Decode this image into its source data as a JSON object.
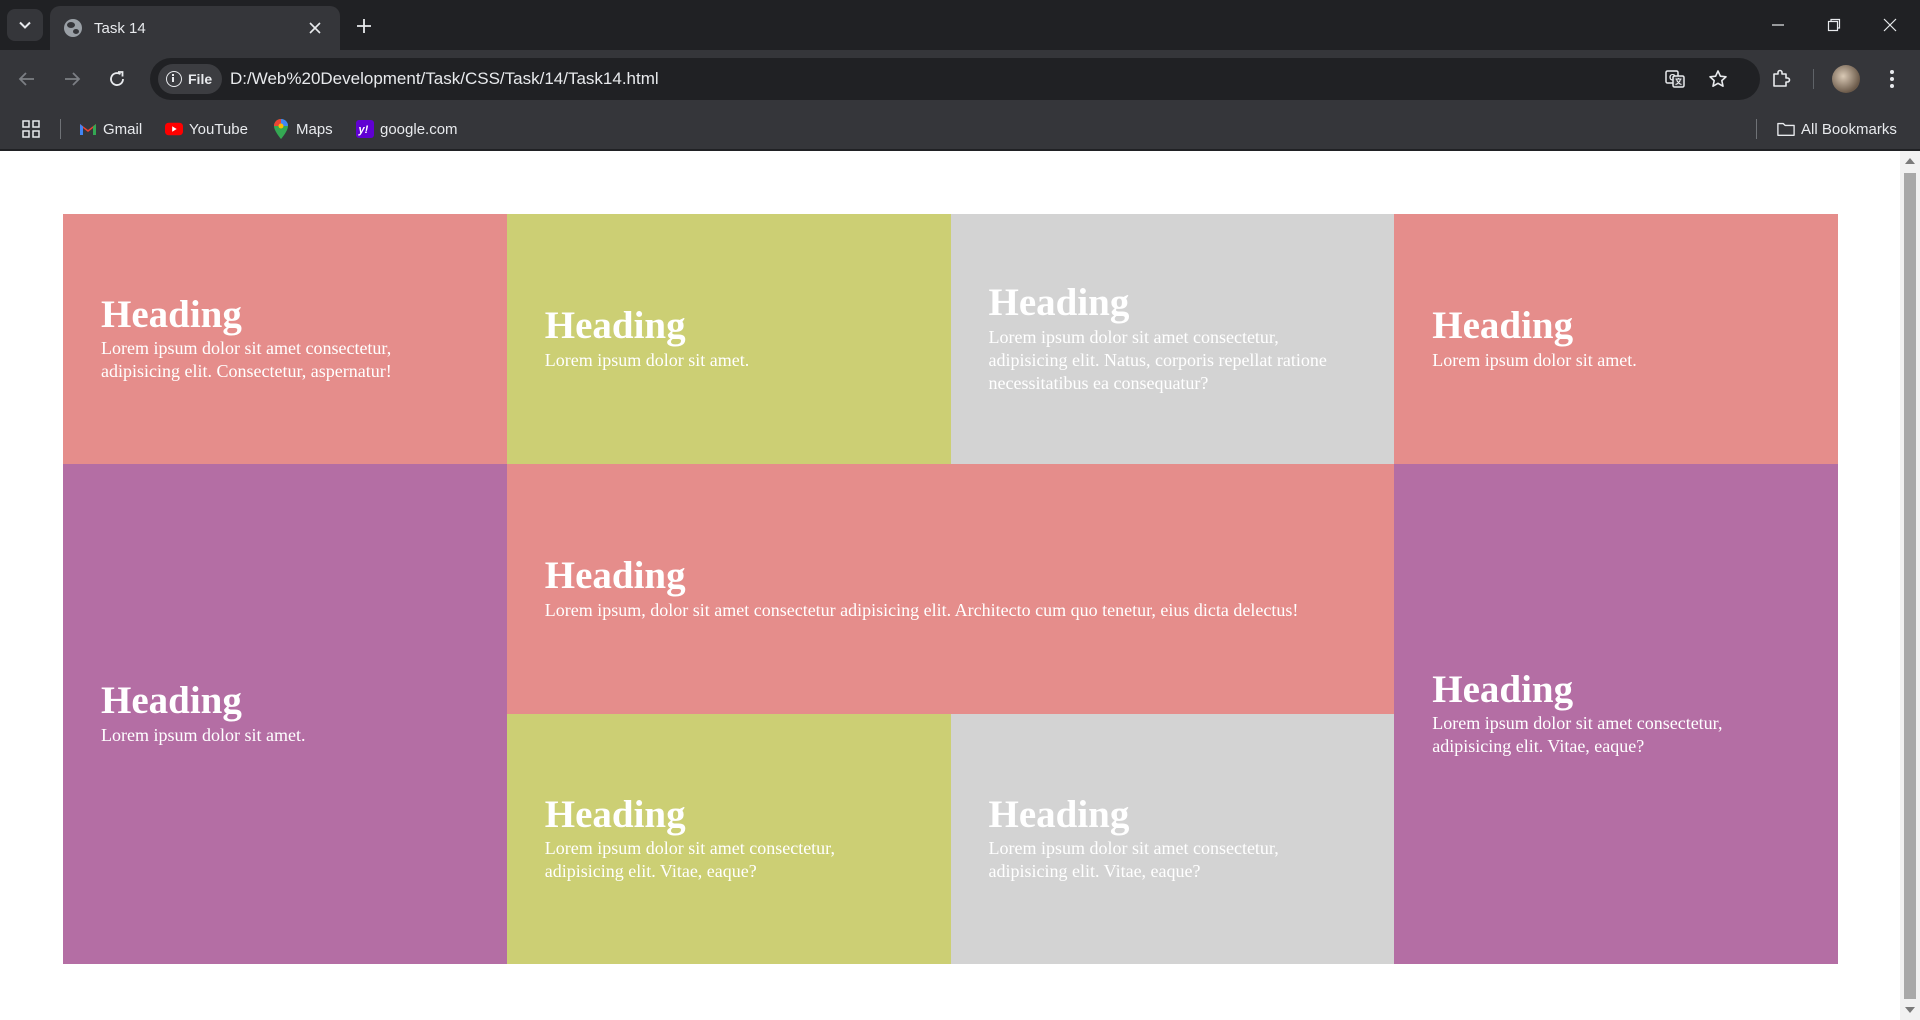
{
  "browser": {
    "tab": {
      "title": "Task 14"
    },
    "address": {
      "chip_label": "File",
      "url": "D:/Web%20Development/Task/CSS/Task/14/Task14.html"
    },
    "bookmarks": [
      {
        "label": "Gmail",
        "icon": "gmail-icon"
      },
      {
        "label": "YouTube",
        "icon": "youtube-icon"
      },
      {
        "label": "Maps",
        "icon": "maps-icon"
      },
      {
        "label": "google.com",
        "icon": "yahoo-icon"
      }
    ],
    "all_bookmarks_label": "All Bookmarks"
  },
  "colors": {
    "pink": "#e58d8b",
    "olive": "#cccf74",
    "gray": "#d3d3d3",
    "purple": "#b46ea4"
  },
  "page": {
    "boxes": [
      {
        "heading": "Heading",
        "text": "Lorem ipsum dolor sit amet consectetur, adipisicing elit. Consectetur, aspernatur!",
        "color": "pink"
      },
      {
        "heading": "Heading",
        "text": "Lorem ipsum dolor sit amet.",
        "color": "olive"
      },
      {
        "heading": "Heading",
        "text": "Lorem ipsum dolor sit amet consectetur, adipisicing elit. Natus, corporis repellat ratione necessitatibus ea consequatur?",
        "color": "gray"
      },
      {
        "heading": "Heading",
        "text": "Lorem ipsum dolor sit amet.",
        "color": "pink"
      },
      {
        "heading": "Heading",
        "text": "Lorem ipsum dolor sit amet.",
        "color": "purple"
      },
      {
        "heading": "Heading",
        "text": "Lorem ipsum, dolor sit amet consectetur adipisicing elit. Architecto cum quo tenetur, eius dicta delectus!",
        "color": "pink"
      },
      {
        "heading": "Heading",
        "text": "Lorem ipsum dolor sit amet consectetur, adipisicing elit. Vitae, eaque?",
        "color": "purple"
      },
      {
        "heading": "Heading",
        "text": "Lorem ipsum dolor sit amet consectetur, adipisicing elit. Vitae, eaque?",
        "color": "olive"
      },
      {
        "heading": "Heading",
        "text": "Lorem ipsum dolor sit amet consectetur, adipisicing elit. Vitae, eaque?",
        "color": "gray"
      }
    ]
  }
}
